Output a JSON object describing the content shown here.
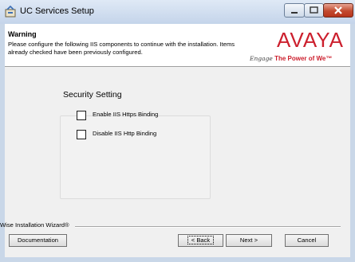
{
  "window": {
    "title": "UC Services Setup"
  },
  "header": {
    "warning_title": "Warning",
    "warning_text": "Please configure the following IIS components to continue with the installation. Items already checked have been previously configured.",
    "logo": {
      "brand": "AVAYA",
      "tagline_script": "Engage",
      "tagline": "The Power of We™",
      "brand_color": "#cc1f2d"
    }
  },
  "security": {
    "group_title": "Security Setting",
    "options": [
      {
        "label": "Enable IIS Https Binding",
        "checked": false
      },
      {
        "label": "Disable IIS Http Binding",
        "checked": false
      }
    ]
  },
  "footer": {
    "wizard_label": "Wise Installation Wizard®",
    "documentation_label": "Documentation",
    "back_label": "< Back",
    "next_label": "Next >",
    "cancel_label": "Cancel"
  }
}
